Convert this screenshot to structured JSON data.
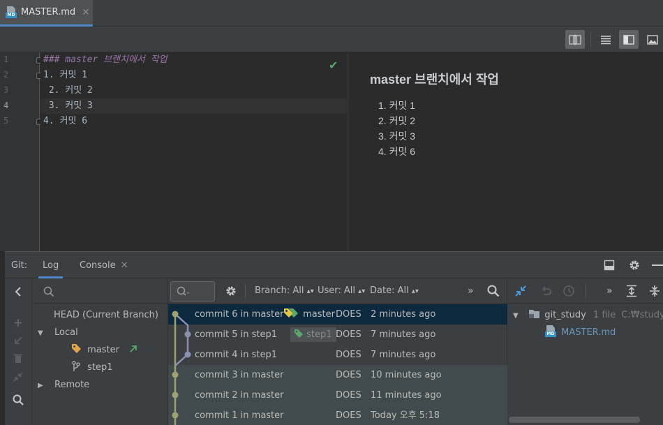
{
  "editor": {
    "tab": {
      "label": "MASTER.md",
      "close": "✕",
      "icon": "markdown-file-icon"
    },
    "lines": [
      {
        "num": "1",
        "text": "### master 브랜치에서 작업"
      },
      {
        "num": "2",
        "text": "1. 커밋 1"
      },
      {
        "num": "3",
        "text": " 2. 커밋 2"
      },
      {
        "num": "4",
        "text": " 3. 커밋 3"
      },
      {
        "num": "5",
        "text": "4. 커밋 6"
      }
    ]
  },
  "preview": {
    "title": "master 브랜치에서 작업",
    "items": [
      "1. 커밋 1",
      "2. 커밋 2",
      "3. 커밋 3",
      "4. 커밋 6"
    ]
  },
  "git": {
    "label": "Git:",
    "tabs": {
      "log": "Log",
      "console": "Console",
      "console_close": "✕"
    },
    "branches": {
      "head": "HEAD (Current Branch)",
      "local": "Local",
      "master": "master",
      "step1": "step1",
      "remote": "Remote"
    },
    "filters": {
      "branch": "Branch: All",
      "user": "User: All",
      "date": "Date: All",
      "more": "»"
    },
    "commits": [
      {
        "subject": "commit 6 in master",
        "author": "DOES",
        "date": "2 minutes ago",
        "ref": "master"
      },
      {
        "subject": "commit 5 in step1",
        "author": "DOES",
        "date": "7 minutes ago",
        "ref": "step1"
      },
      {
        "subject": "commit 4 in step1",
        "author": "DOES",
        "date": "7 minutes ago"
      },
      {
        "subject": "commit 3 in master",
        "author": "DOES",
        "date": "10 minutes ago"
      },
      {
        "subject": "commit 2 in master",
        "author": "DOES",
        "date": "11 minutes ago"
      },
      {
        "subject": "commit 1 in master",
        "author": "DOES",
        "date": "Today 오후 5:18"
      }
    ],
    "files": {
      "root": "git_study",
      "count": "1 file",
      "path": "C:₩study₩",
      "file": "MASTER.md",
      "more": "»"
    }
  },
  "colors": {
    "accent": "#4a88c7",
    "master_tag": "#e0c643",
    "step1_tag": "#59a869",
    "graph_master": "#9ea26f",
    "graph_step1": "#8a8fb1",
    "selected_row": "#0d293e"
  }
}
